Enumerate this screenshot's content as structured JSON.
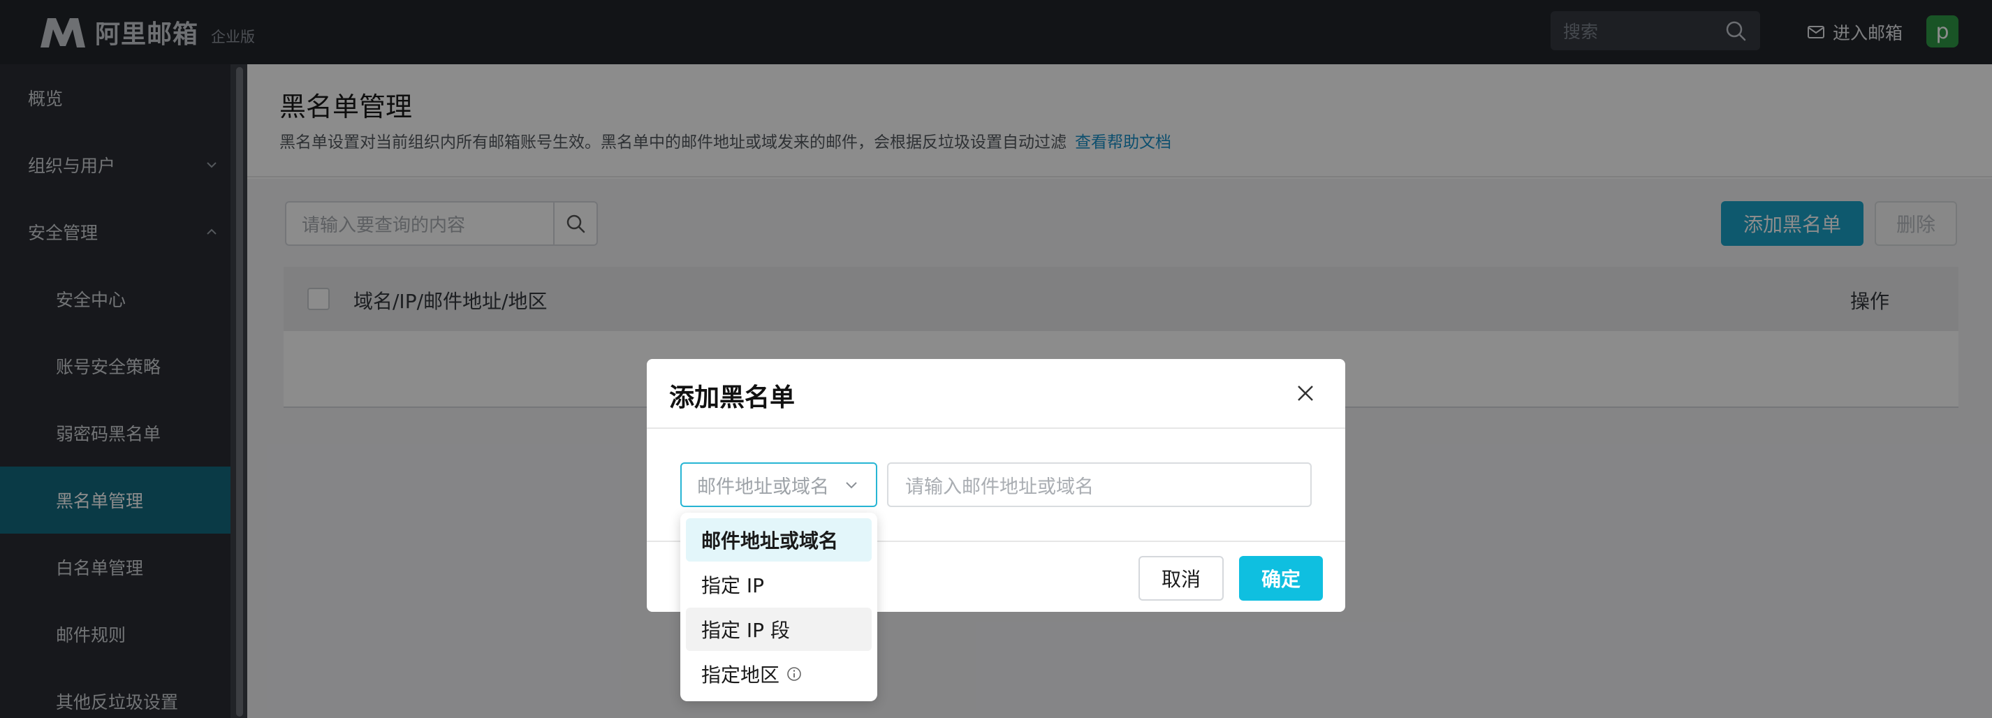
{
  "brand": {
    "name": "阿里邮箱",
    "edition": "企业版"
  },
  "topbar": {
    "search_placeholder": "搜索",
    "enter_mail_label": "进入邮箱",
    "avatar_letter": "p"
  },
  "sidebar": {
    "items": [
      {
        "label": "概览"
      },
      {
        "label": "组织与用户"
      },
      {
        "label": "安全管理"
      },
      {
        "label": "安全中心"
      },
      {
        "label": "账号安全策略"
      },
      {
        "label": "弱密码黑名单"
      },
      {
        "label": "黑名单管理"
      },
      {
        "label": "白名单管理"
      },
      {
        "label": "邮件规则"
      },
      {
        "label": "其他反垃圾设置"
      }
    ],
    "active": "黑名单管理"
  },
  "page": {
    "title": "黑名单管理",
    "description": "黑名单设置对当前组织内所有邮箱账号生效。黑名单中的邮件地址或域发来的邮件，会根据反垃圾设置自动过滤",
    "help_link": "查看帮助文档",
    "search_placeholder": "请输入要查询的内容",
    "add_button": "添加黑名单",
    "delete_button": "删除",
    "table_headers": [
      "域名/IP/邮件地址/地区",
      "操作"
    ]
  },
  "modal": {
    "title": "添加黑名单",
    "select_value": "邮件地址或域名",
    "input_placeholder": "请输入邮件地址或域名",
    "cancel_button": "取消",
    "ok_button": "确定",
    "options": [
      "邮件地址或域名",
      "指定 IP",
      "指定 IP 段",
      "指定地区"
    ],
    "selected_option": "邮件地址或域名",
    "hovered_option": "指定 IP 段"
  },
  "colors": {
    "topbar_bg": "#22252b",
    "sidebar_bg": "#2a2d33",
    "sidebar_active": "#136a80",
    "primary": "#1aa3c9",
    "ok_button": "#0fbfe0",
    "link": "#1990c8",
    "avatar": "#2f9a45"
  }
}
